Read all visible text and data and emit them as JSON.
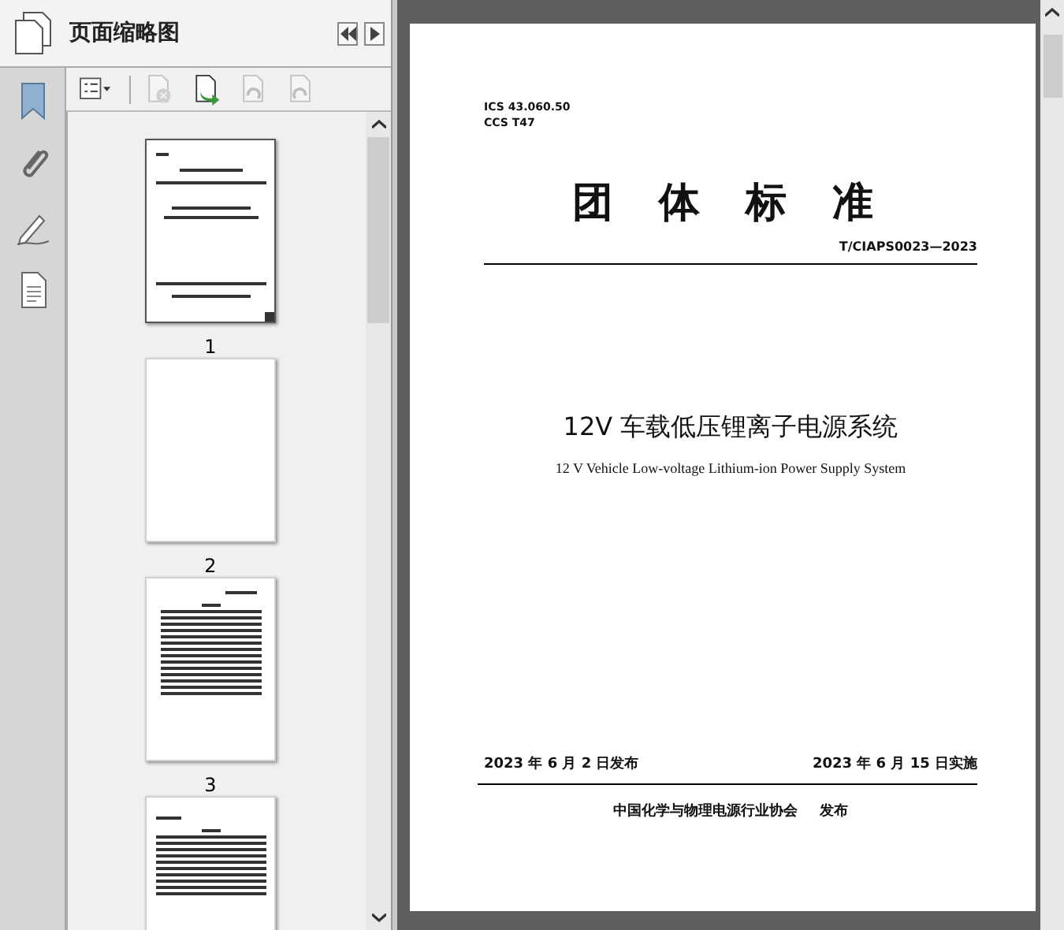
{
  "panel": {
    "title": "页面缩略图",
    "toolbar": [
      {
        "kind": "options",
        "disabled": false
      },
      {
        "kind": "delete",
        "disabled": true
      },
      {
        "kind": "insert",
        "disabled": false
      },
      {
        "kind": "rotate-left",
        "disabled": true
      },
      {
        "kind": "rotate-right",
        "disabled": true
      }
    ],
    "thumbnails": [
      {
        "label": "1",
        "kind": "cover",
        "selected": true
      },
      {
        "label": "2",
        "kind": "blank",
        "selected": false
      },
      {
        "label": "3",
        "kind": "contents",
        "selected": false
      },
      {
        "kind": "text",
        "selected": false
      }
    ]
  },
  "rail": [
    {
      "kind": "bookmark"
    },
    {
      "kind": "attachment"
    },
    {
      "kind": "signature"
    },
    {
      "kind": "document"
    }
  ],
  "document": {
    "ics": "ICS 43.060.50",
    "ccs": "CCS T47",
    "heading": "团 体 标 准",
    "code": "T/CIAPS0023—2023",
    "title": "12V 车载低压锂离子电源系统",
    "subtitle": "12 V Vehicle Low-voltage Lithium-ion Power Supply System",
    "published": "2023 年 6 月 2 日发布",
    "effective": "2023 年 6 月 15 日实施",
    "publisher": "中国化学与物理电源行业协会",
    "publisher_note": "发布"
  }
}
